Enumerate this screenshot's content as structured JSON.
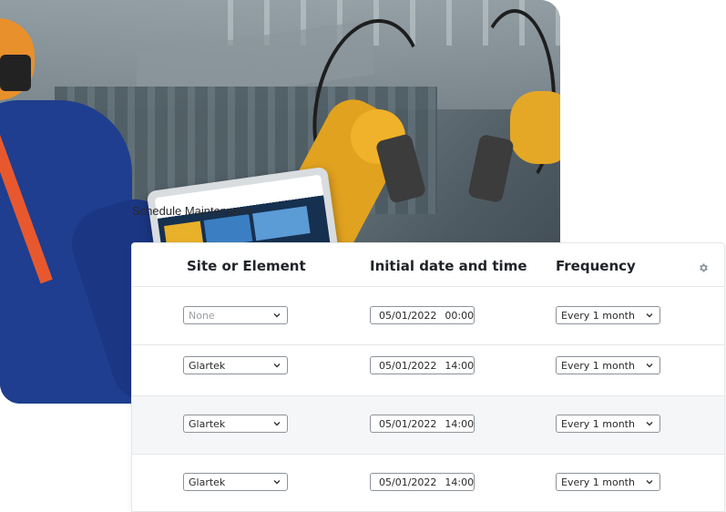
{
  "photo": {
    "tablet_caption": "Schedule Maintenance"
  },
  "table": {
    "headers": {
      "site": "Site or Element",
      "date": "Initial date and time",
      "frequency": "Frequency"
    },
    "settings_icon": "gear-icon",
    "rows": [
      {
        "site": "None",
        "site_is_placeholder": true,
        "date": "05/01/2022",
        "time": "00:00",
        "frequency": "Every 1 month"
      },
      {
        "site": "Glartek",
        "site_is_placeholder": false,
        "date": "05/01/2022",
        "time": "14:00",
        "frequency": "Every 1 month"
      },
      {
        "site": "Glartek",
        "site_is_placeholder": false,
        "date": "05/01/2022",
        "time": "14:00",
        "frequency": "Every 1 month"
      },
      {
        "site": "Glartek",
        "site_is_placeholder": false,
        "date": "05/01/2022",
        "time": "14:00",
        "frequency": "Every 1 month"
      }
    ]
  },
  "colors": {
    "border": "#e4e7ea",
    "row_alt": "#f5f6f8",
    "control_border": "#8c9399"
  }
}
